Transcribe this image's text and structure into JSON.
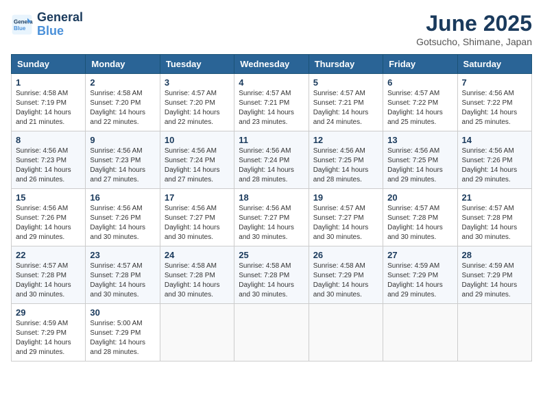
{
  "header": {
    "logo_line1": "General",
    "logo_line2": "Blue",
    "title": "June 2025",
    "location": "Gotsucho, Shimane, Japan"
  },
  "days_of_week": [
    "Sunday",
    "Monday",
    "Tuesday",
    "Wednesday",
    "Thursday",
    "Friday",
    "Saturday"
  ],
  "weeks": [
    [
      {
        "day": "1",
        "sunrise": "4:58 AM",
        "sunset": "7:19 PM",
        "daylight": "14 hours and 21 minutes."
      },
      {
        "day": "2",
        "sunrise": "4:58 AM",
        "sunset": "7:20 PM",
        "daylight": "14 hours and 22 minutes."
      },
      {
        "day": "3",
        "sunrise": "4:57 AM",
        "sunset": "7:20 PM",
        "daylight": "14 hours and 22 minutes."
      },
      {
        "day": "4",
        "sunrise": "4:57 AM",
        "sunset": "7:21 PM",
        "daylight": "14 hours and 23 minutes."
      },
      {
        "day": "5",
        "sunrise": "4:57 AM",
        "sunset": "7:21 PM",
        "daylight": "14 hours and 24 minutes."
      },
      {
        "day": "6",
        "sunrise": "4:57 AM",
        "sunset": "7:22 PM",
        "daylight": "14 hours and 25 minutes."
      },
      {
        "day": "7",
        "sunrise": "4:56 AM",
        "sunset": "7:22 PM",
        "daylight": "14 hours and 25 minutes."
      }
    ],
    [
      {
        "day": "8",
        "sunrise": "4:56 AM",
        "sunset": "7:23 PM",
        "daylight": "14 hours and 26 minutes."
      },
      {
        "day": "9",
        "sunrise": "4:56 AM",
        "sunset": "7:23 PM",
        "daylight": "14 hours and 27 minutes."
      },
      {
        "day": "10",
        "sunrise": "4:56 AM",
        "sunset": "7:24 PM",
        "daylight": "14 hours and 27 minutes."
      },
      {
        "day": "11",
        "sunrise": "4:56 AM",
        "sunset": "7:24 PM",
        "daylight": "14 hours and 28 minutes."
      },
      {
        "day": "12",
        "sunrise": "4:56 AM",
        "sunset": "7:25 PM",
        "daylight": "14 hours and 28 minutes."
      },
      {
        "day": "13",
        "sunrise": "4:56 AM",
        "sunset": "7:25 PM",
        "daylight": "14 hours and 29 minutes."
      },
      {
        "day": "14",
        "sunrise": "4:56 AM",
        "sunset": "7:26 PM",
        "daylight": "14 hours and 29 minutes."
      }
    ],
    [
      {
        "day": "15",
        "sunrise": "4:56 AM",
        "sunset": "7:26 PM",
        "daylight": "14 hours and 29 minutes."
      },
      {
        "day": "16",
        "sunrise": "4:56 AM",
        "sunset": "7:26 PM",
        "daylight": "14 hours and 30 minutes."
      },
      {
        "day": "17",
        "sunrise": "4:56 AM",
        "sunset": "7:27 PM",
        "daylight": "14 hours and 30 minutes."
      },
      {
        "day": "18",
        "sunrise": "4:56 AM",
        "sunset": "7:27 PM",
        "daylight": "14 hours and 30 minutes."
      },
      {
        "day": "19",
        "sunrise": "4:57 AM",
        "sunset": "7:27 PM",
        "daylight": "14 hours and 30 minutes."
      },
      {
        "day": "20",
        "sunrise": "4:57 AM",
        "sunset": "7:28 PM",
        "daylight": "14 hours and 30 minutes."
      },
      {
        "day": "21",
        "sunrise": "4:57 AM",
        "sunset": "7:28 PM",
        "daylight": "14 hours and 30 minutes."
      }
    ],
    [
      {
        "day": "22",
        "sunrise": "4:57 AM",
        "sunset": "7:28 PM",
        "daylight": "14 hours and 30 minutes."
      },
      {
        "day": "23",
        "sunrise": "4:57 AM",
        "sunset": "7:28 PM",
        "daylight": "14 hours and 30 minutes."
      },
      {
        "day": "24",
        "sunrise": "4:58 AM",
        "sunset": "7:28 PM",
        "daylight": "14 hours and 30 minutes."
      },
      {
        "day": "25",
        "sunrise": "4:58 AM",
        "sunset": "7:28 PM",
        "daylight": "14 hours and 30 minutes."
      },
      {
        "day": "26",
        "sunrise": "4:58 AM",
        "sunset": "7:29 PM",
        "daylight": "14 hours and 30 minutes."
      },
      {
        "day": "27",
        "sunrise": "4:59 AM",
        "sunset": "7:29 PM",
        "daylight": "14 hours and 29 minutes."
      },
      {
        "day": "28",
        "sunrise": "4:59 AM",
        "sunset": "7:29 PM",
        "daylight": "14 hours and 29 minutes."
      }
    ],
    [
      {
        "day": "29",
        "sunrise": "4:59 AM",
        "sunset": "7:29 PM",
        "daylight": "14 hours and 29 minutes."
      },
      {
        "day": "30",
        "sunrise": "5:00 AM",
        "sunset": "7:29 PM",
        "daylight": "14 hours and 28 minutes."
      },
      null,
      null,
      null,
      null,
      null
    ]
  ]
}
